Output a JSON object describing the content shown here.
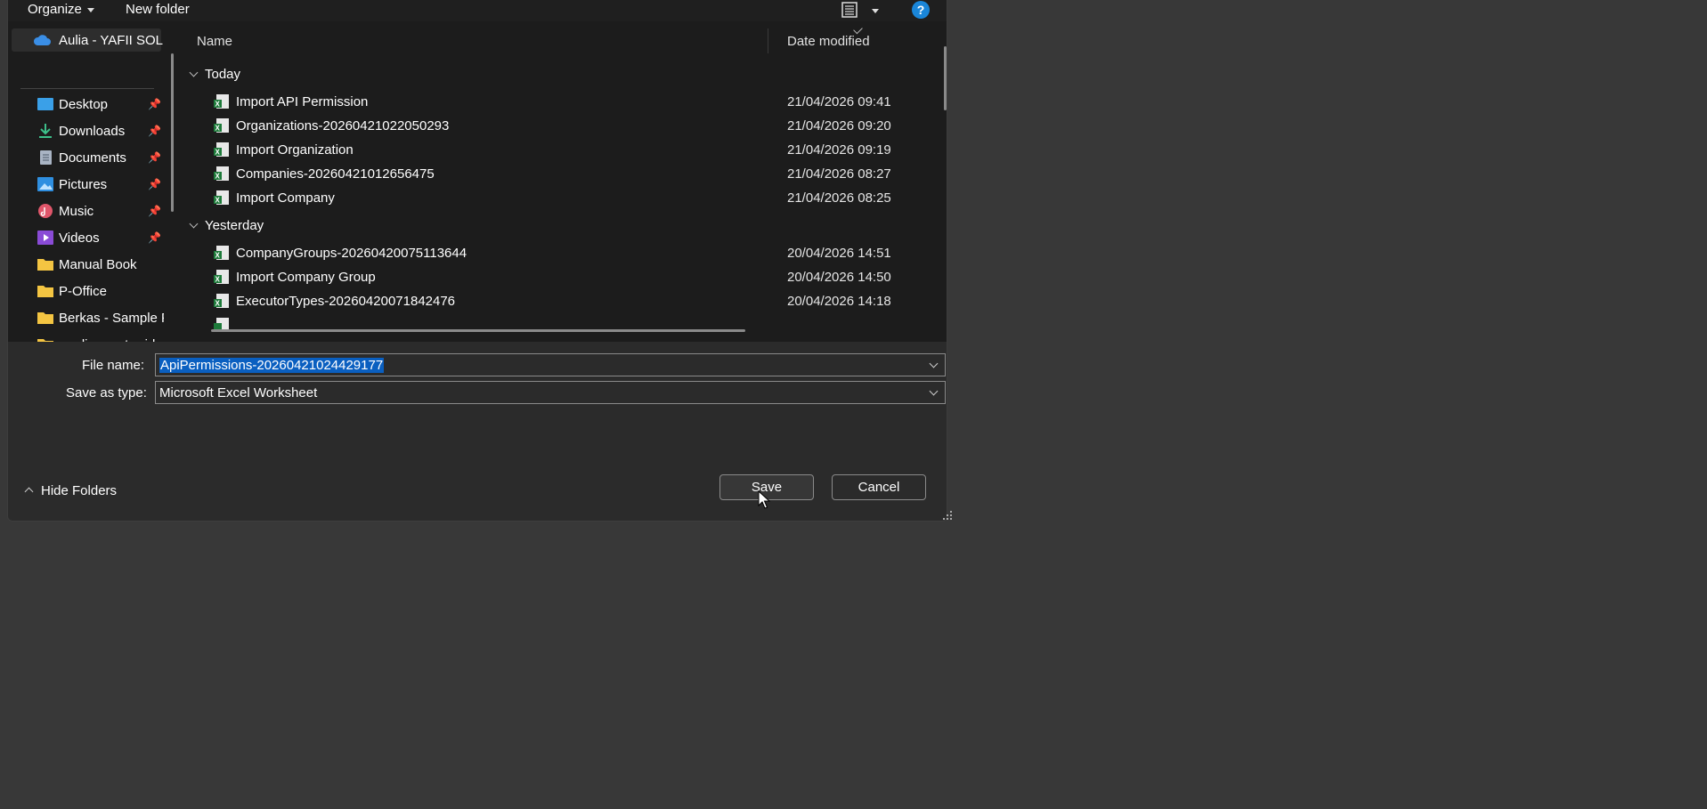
{
  "toolbar": {
    "organize_label": "Organize",
    "new_folder_label": "New folder",
    "help_label": "?"
  },
  "nav": {
    "onedrive_label": "Aulia - YAFII SOLU",
    "items": [
      {
        "label": "Desktop",
        "icon": "desktop-icon",
        "pinned": true
      },
      {
        "label": "Downloads",
        "icon": "downloads-icon",
        "pinned": true
      },
      {
        "label": "Documents",
        "icon": "documents-icon",
        "pinned": true
      },
      {
        "label": "Pictures",
        "icon": "pictures-icon",
        "pinned": true
      },
      {
        "label": "Music",
        "icon": "music-icon",
        "pinned": true
      },
      {
        "label": "Videos",
        "icon": "videos-icon",
        "pinned": true
      },
      {
        "label": "Manual Book",
        "icon": "folder-icon",
        "pinned": false
      },
      {
        "label": "P-Office",
        "icon": "folder-icon",
        "pinned": false
      },
      {
        "label": "Berkas - Sample F",
        "icon": "folder-icon",
        "pinned": false
      },
      {
        "label": "media-master-ide",
        "icon": "folder-icon",
        "pinned": false
      }
    ]
  },
  "file_list": {
    "columns": {
      "name": "Name",
      "date_modified": "Date modified"
    },
    "groups": [
      {
        "label": "Today",
        "files": [
          {
            "name": "Import API Permission",
            "date": "21/04/2026 09:41"
          },
          {
            "name": "Organizations-20260421022050293",
            "date": "21/04/2026 09:20"
          },
          {
            "name": "Import Organization",
            "date": "21/04/2026 09:19"
          },
          {
            "name": "Companies-20260421012656475",
            "date": "21/04/2026 08:27"
          },
          {
            "name": "Import Company",
            "date": "21/04/2026 08:25"
          }
        ]
      },
      {
        "label": "Yesterday",
        "files": [
          {
            "name": "CompanyGroups-20260420075113644",
            "date": "20/04/2026 14:51"
          },
          {
            "name": "Import Company Group",
            "date": "20/04/2026 14:50"
          },
          {
            "name": "ExecutorTypes-20260420071842476",
            "date": "20/04/2026 14:18"
          }
        ]
      }
    ]
  },
  "form": {
    "file_name_label": "File name:",
    "file_name_value": "ApiPermissions-20260421024429177",
    "save_type_label": "Save as type:",
    "save_type_value": "Microsoft Excel Worksheet"
  },
  "footer": {
    "hide_folders_label": "Hide Folders",
    "save_label": "Save",
    "cancel_label": "Cancel"
  },
  "colors": {
    "background": "#383838",
    "panel": "#1c1c1c",
    "selection": "#0a5fc0",
    "help": "#1a86d9",
    "excel_green": "#1d7a3a"
  }
}
